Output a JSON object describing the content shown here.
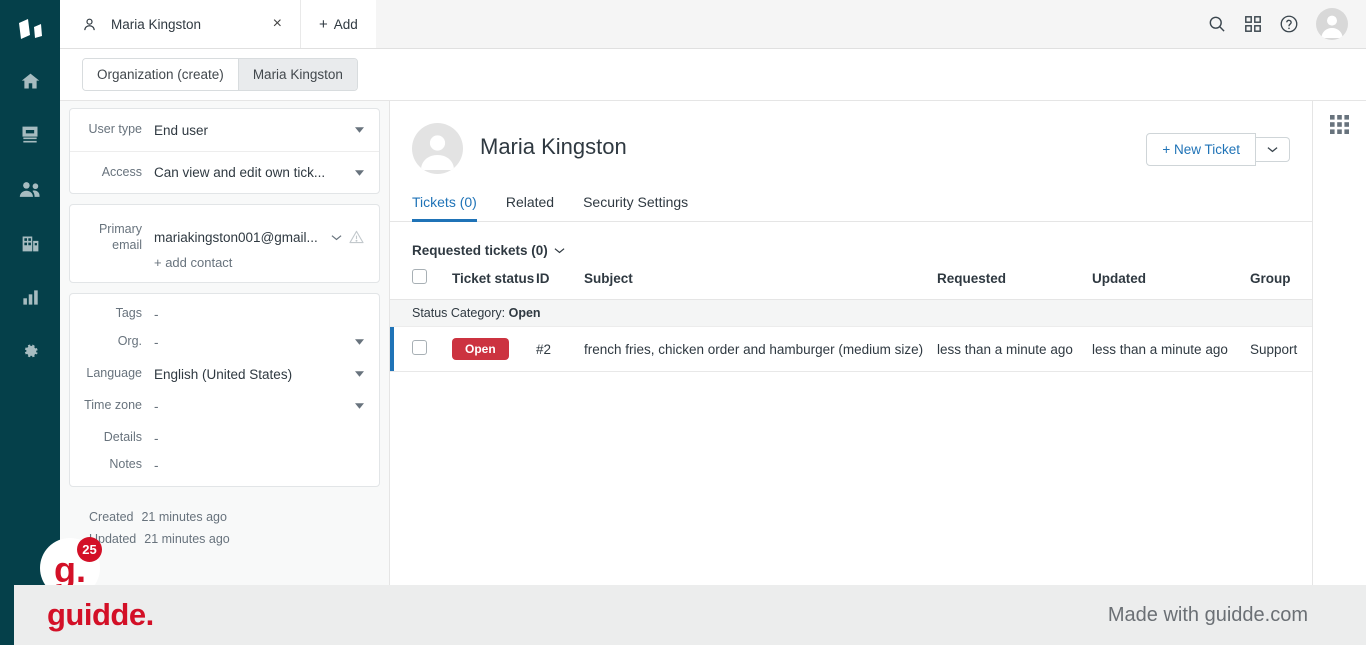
{
  "rail": {
    "logo": "zendesk-logo",
    "items": [
      {
        "name": "home",
        "icon": "home-icon"
      },
      {
        "name": "views",
        "icon": "views-icon"
      },
      {
        "name": "customers",
        "icon": "customers-icon"
      },
      {
        "name": "organizations",
        "icon": "organizations-icon"
      },
      {
        "name": "reporting",
        "icon": "reporting-icon"
      },
      {
        "name": "admin",
        "icon": "gear-icon"
      }
    ]
  },
  "topbar": {
    "tab": {
      "label": "Maria Kingston",
      "icon": "user-icon",
      "close": "×"
    },
    "add": {
      "plus": "+",
      "label": "Add"
    },
    "actions": [
      {
        "name": "search-icon"
      },
      {
        "name": "apps-grid-icon"
      },
      {
        "name": "help-icon"
      },
      {
        "name": "avatar"
      }
    ]
  },
  "subbar": {
    "segments": [
      {
        "label": "Organization (create)",
        "active": false
      },
      {
        "label": "Maria Kingston",
        "active": true
      }
    ]
  },
  "left_panel": {
    "card1": [
      {
        "label": "User type",
        "value": "End user",
        "caret": true
      },
      {
        "label": "Access",
        "value": "Can view and edit own tick...",
        "caret": true
      }
    ],
    "email": {
      "label_line1": "Primary",
      "label_line2": "email",
      "value": "mariakingston001@gmail...",
      "warning": "warning-icon"
    },
    "add_contact": "+ add contact",
    "card3": [
      {
        "label": "Tags",
        "value": "-",
        "caret": false
      },
      {
        "label": "Org.",
        "value": "-",
        "caret": true
      },
      {
        "label": "Language",
        "value": "English (United States)",
        "caret": true
      },
      {
        "label": "Time zone",
        "value": "-",
        "caret": true
      },
      {
        "label": "Details",
        "value": "-",
        "caret": false
      },
      {
        "label": "Notes",
        "value": "-",
        "caret": false
      }
    ],
    "timestamps": [
      {
        "key": "Created",
        "value": "21 minutes ago"
      },
      {
        "key": "Updated",
        "value": "21 minutes ago"
      }
    ]
  },
  "main": {
    "user_name": "Maria Kingston",
    "avatar": "user-avatar",
    "new_ticket_label": "+ New Ticket",
    "tabs": [
      {
        "label": "Tickets (0)",
        "active": true
      },
      {
        "label": "Related",
        "active": false
      },
      {
        "label": "Security Settings",
        "active": false
      }
    ],
    "list_title": "Requested tickets (0)",
    "table": {
      "columns": [
        "Ticket status",
        "ID",
        "Subject",
        "Requested",
        "Updated",
        "Group"
      ],
      "group_header": {
        "label": "Status Category:",
        "value": "Open"
      },
      "rows": [
        {
          "status": "Open",
          "id": "#2",
          "subject": "french fries, chicken order and hamburger (medium size)",
          "requested": "less than a minute ago",
          "updated": "less than a minute ago",
          "group": "Support"
        }
      ]
    }
  },
  "apps_pane": {
    "icon": "apps-grid-icon"
  },
  "guidde": {
    "logo": "guidde.",
    "made_with": "Made with guidde.com",
    "badge_count": "25",
    "badge_mark": "g."
  },
  "colors": {
    "rail_bg": "#05404a",
    "accent_blue": "#1f73b7",
    "status_open_red": "#cc3340",
    "guidde_red": "#d31027"
  }
}
